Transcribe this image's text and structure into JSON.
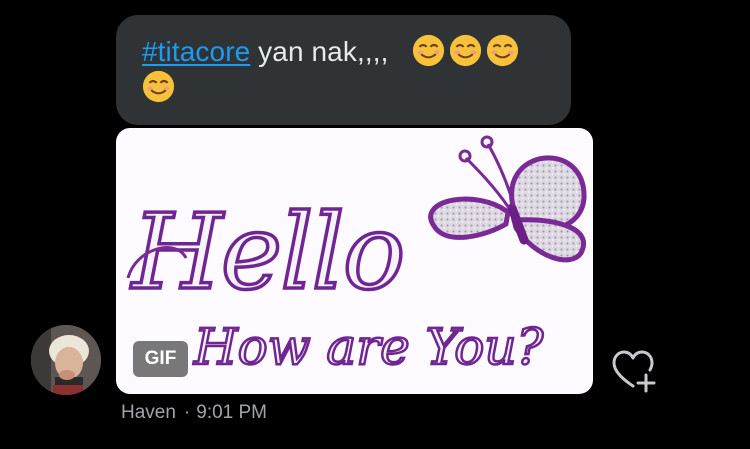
{
  "message": {
    "hashtag": "#titacore",
    "text": " yan nak,,,,",
    "emojis": [
      "smiling-face-emoji",
      "smiling-face-emoji",
      "smiling-face-emoji",
      "smiling-face-emoji"
    ]
  },
  "gif": {
    "badge": "GIF",
    "line1": "Hello",
    "line2": "How are You?"
  },
  "sender": {
    "name": "Haven",
    "separator": "·",
    "time": "9:01 PM"
  },
  "actions": {
    "react_icon": "heart-plus-icon"
  }
}
